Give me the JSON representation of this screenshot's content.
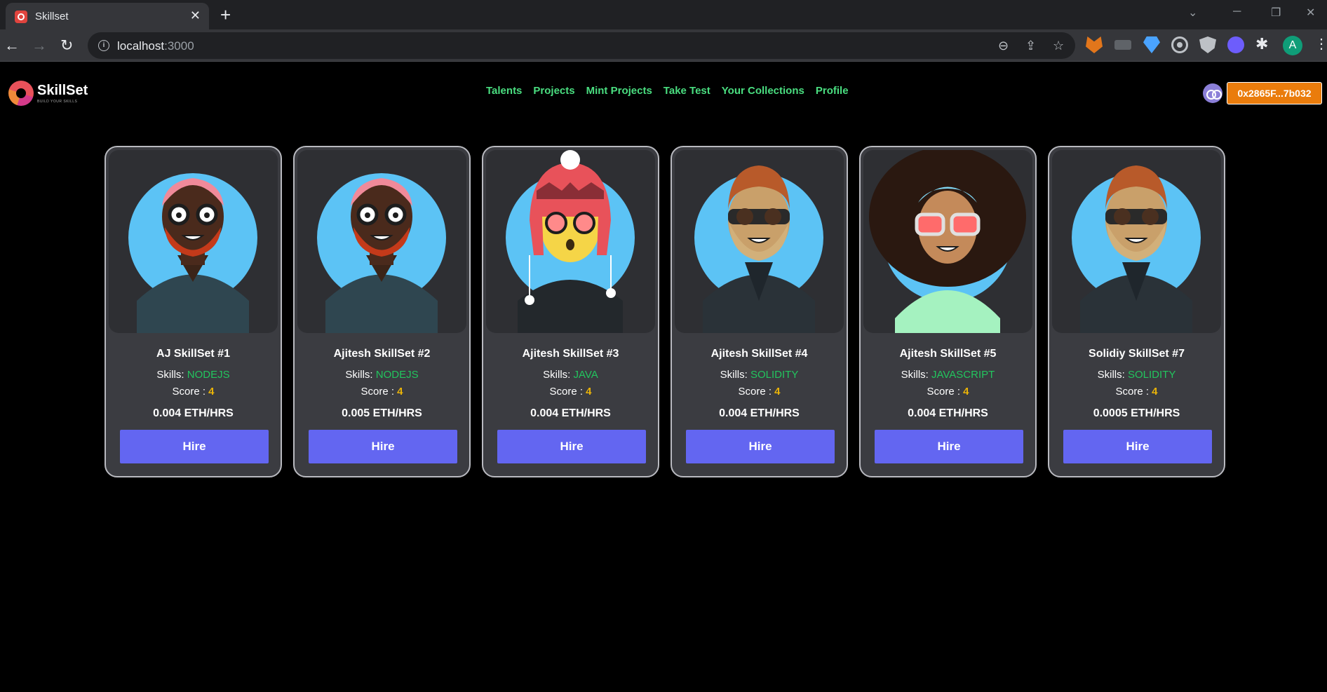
{
  "browser": {
    "tab_title": "Skillset",
    "url_host": "localhost",
    "url_port": ":3000"
  },
  "brand": {
    "name": "SkillSet",
    "tagline": "BUILD YOUR SKILLS"
  },
  "nav": {
    "items": [
      "Talents",
      "Projects",
      "Mint Projects",
      "Take Test",
      "Your Collections",
      "Profile"
    ]
  },
  "wallet": {
    "address": "0x2865F...7b032"
  },
  "labels": {
    "skills": "Skills: ",
    "score": "Score : ",
    "hire": "Hire"
  },
  "colors": {
    "nav_link": "#4ade80",
    "skill_value": "#22c55e",
    "score_value": "#eab308",
    "hire_button": "#6366f1",
    "wallet_button": "#ea7c0c",
    "card_background": "#3b3c41"
  },
  "cards": [
    {
      "name": "AJ SkillSet #1",
      "skill": "NODEJS",
      "score": "4",
      "price": "0.004 ETH/HRS",
      "avatar": "avatar-bald-red-beard"
    },
    {
      "name": "Ajitesh SkillSet #2",
      "skill": "NODEJS",
      "score": "4",
      "price": "0.005 ETH/HRS",
      "avatar": "avatar-bald-red-beard"
    },
    {
      "name": "Ajitesh SkillSet #3",
      "skill": "JAVA",
      "score": "4",
      "price": "0.004 ETH/HRS",
      "avatar": "avatar-winter-hat"
    },
    {
      "name": "Ajitesh SkillSet #4",
      "skill": "SOLIDITY",
      "score": "4",
      "price": "0.004 ETH/HRS",
      "avatar": "avatar-brown-hair-beard"
    },
    {
      "name": "Ajitesh SkillSet #5",
      "skill": "JAVASCRIPT",
      "score": "4",
      "price": "0.004 ETH/HRS",
      "avatar": "avatar-afro"
    },
    {
      "name": "Solidiy SkillSet #7",
      "skill": "SOLIDITY",
      "score": "4",
      "price": "0.0005 ETH/HRS",
      "avatar": "avatar-brown-hair-beard"
    }
  ]
}
